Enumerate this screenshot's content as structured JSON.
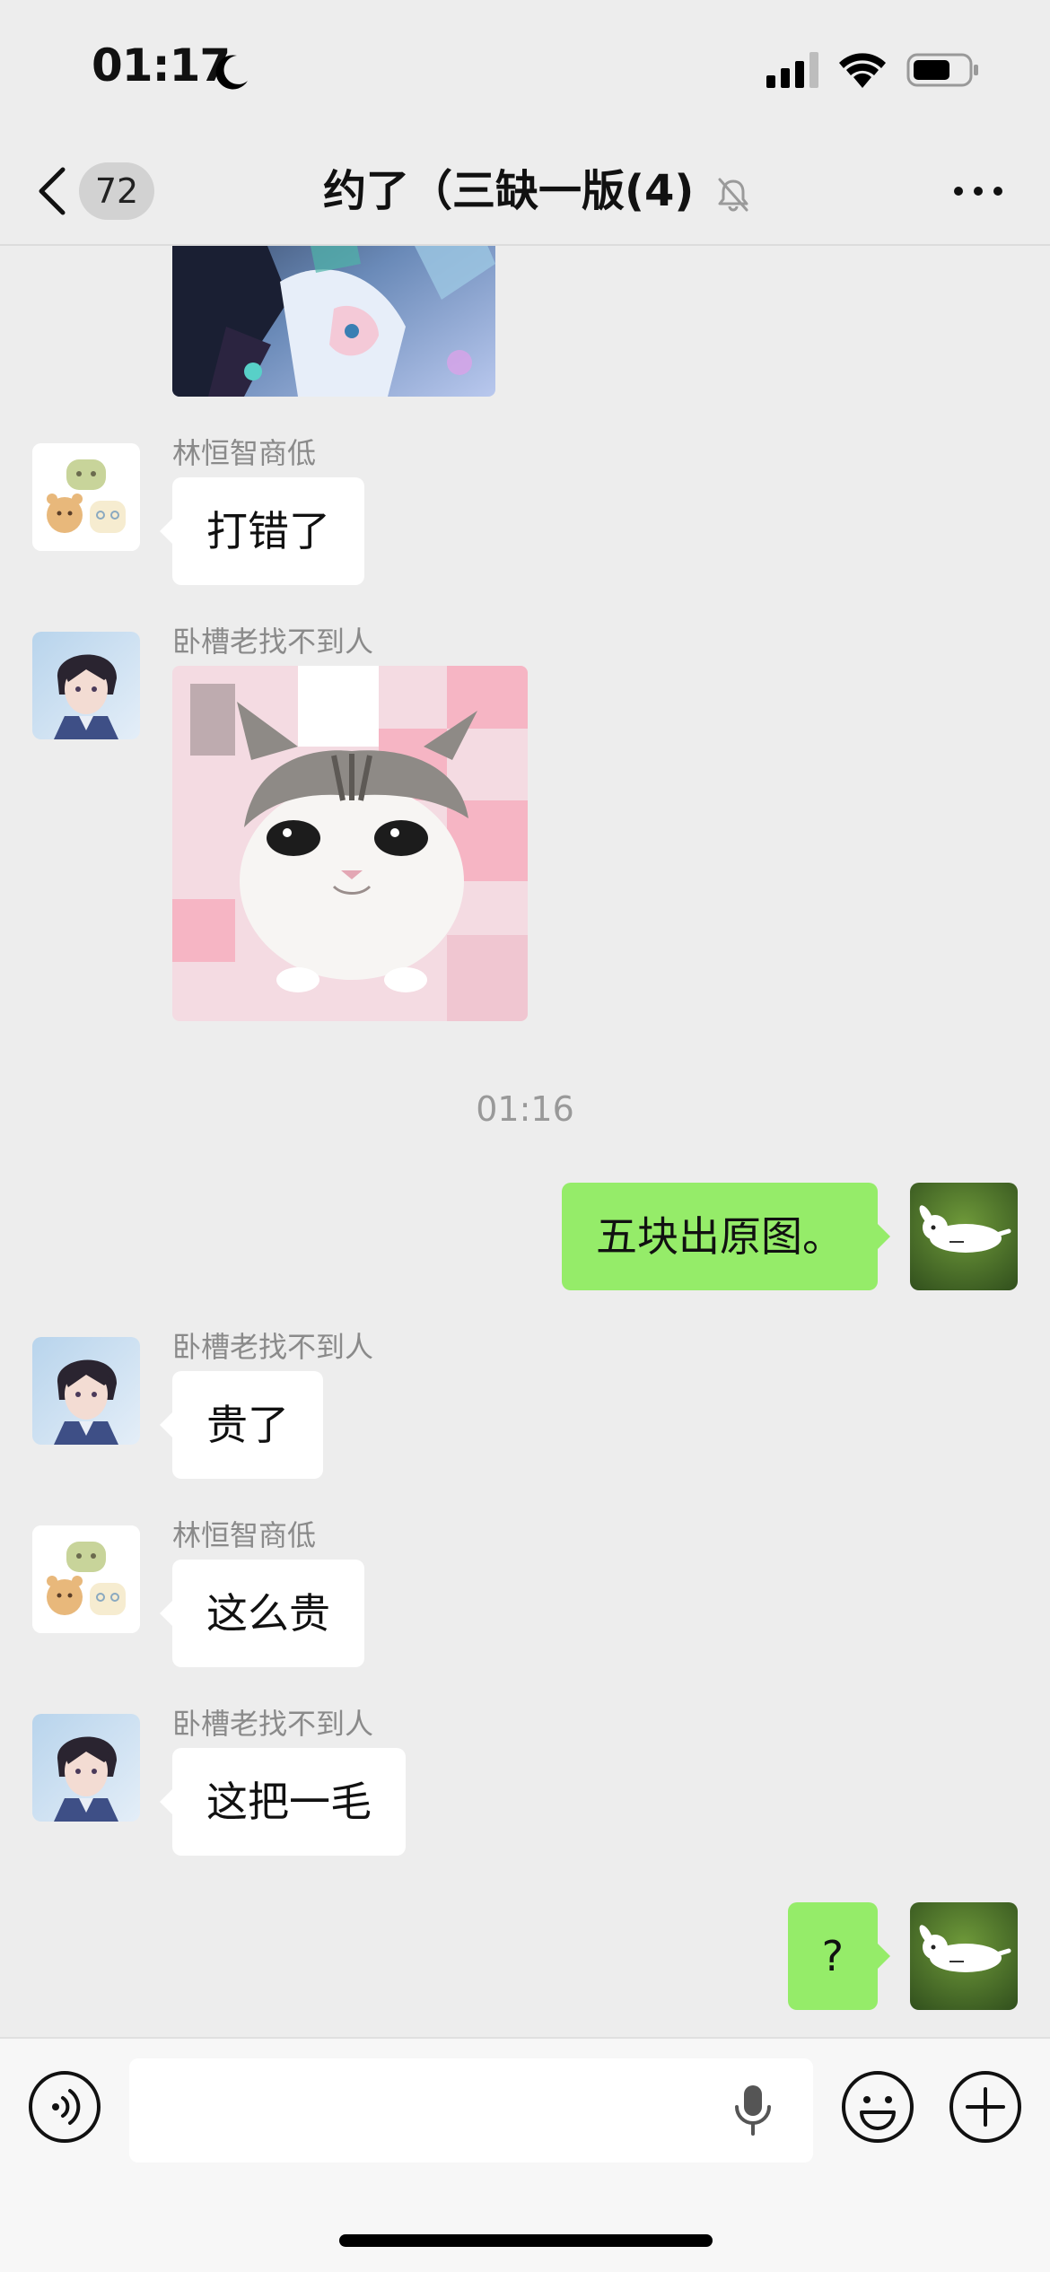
{
  "status_bar": {
    "time": "01:17"
  },
  "nav": {
    "unread_count": "72",
    "title": "约了（三缺一版(4)"
  },
  "messages": [
    {
      "type": "image",
      "direction": "in",
      "description": "anime illustration (partially scrolled)"
    },
    {
      "type": "text",
      "direction": "in",
      "sender": "林恒智商低",
      "text": "打错了"
    },
    {
      "type": "image",
      "direction": "in",
      "sender": "卧槽老找不到人",
      "description": "crying cat sticker"
    },
    {
      "type": "time",
      "text": "01:16"
    },
    {
      "type": "text",
      "direction": "out",
      "text": "五块出原图。"
    },
    {
      "type": "text",
      "direction": "in",
      "sender": "卧槽老找不到人",
      "text": "贵了"
    },
    {
      "type": "text",
      "direction": "in",
      "sender": "林恒智商低",
      "text": "这么贵"
    },
    {
      "type": "text",
      "direction": "in",
      "sender": "卧槽老找不到人",
      "text": "这把一毛"
    },
    {
      "type": "text",
      "direction": "out",
      "text": "?"
    }
  ],
  "input": {
    "value": "",
    "placeholder": ""
  },
  "colors": {
    "background": "#ededed",
    "bubble_out": "#95ec69",
    "bubble_in": "#ffffff",
    "badge": "#d2d2d2"
  },
  "icons": [
    "moon-icon",
    "signal-icon",
    "wifi-icon",
    "battery-icon",
    "back-chevron-icon",
    "mute-bell-icon",
    "more-icon",
    "voice-icon",
    "mic-icon",
    "emoji-icon",
    "plus-icon"
  ]
}
